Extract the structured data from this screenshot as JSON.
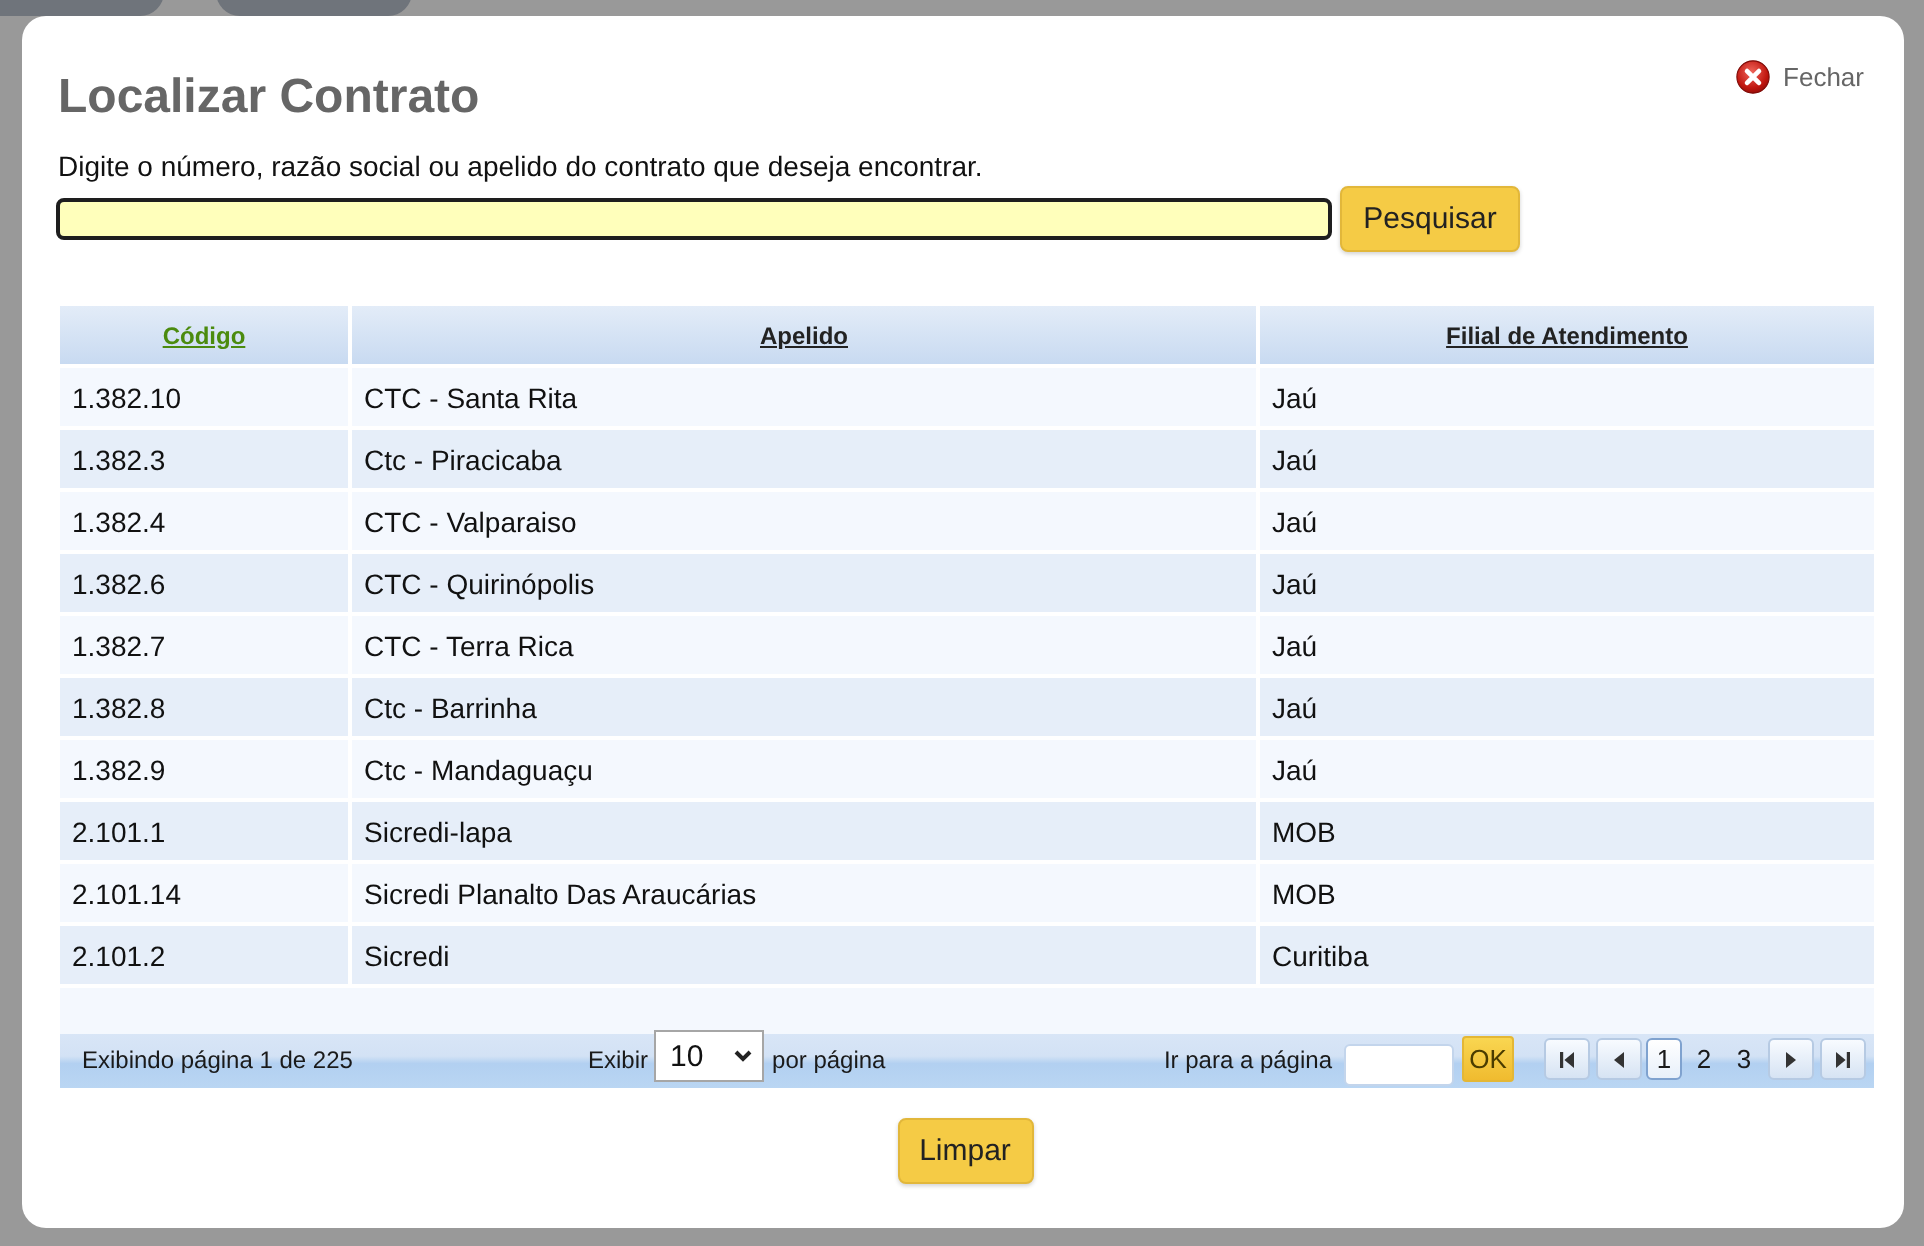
{
  "dialog": {
    "title": "Localizar Contrato",
    "close_label": "Fechar",
    "instruction": "Digite o número, razão social ou apelido do contrato que deseja encontrar.",
    "search_field": {
      "focused": true
    },
    "search_button": "Pesquisar"
  },
  "table": {
    "columns": [
      {
        "label": "Código",
        "sorted": true
      },
      {
        "label": "Apelido",
        "sorted": false
      },
      {
        "label": "Filial de Atendimento",
        "sorted": false
      }
    ],
    "rows": [
      {
        "cells": [
          "1.382.10",
          "CTC - Santa Rita",
          "Jaú"
        ]
      },
      {
        "cells": [
          "1.382.3",
          "Ctc - Piracicaba",
          "Jaú"
        ]
      },
      {
        "cells": [
          "1.382.4",
          "CTC - Valparaiso",
          "Jaú"
        ]
      },
      {
        "cells": [
          "1.382.6",
          "CTC - Quirinópolis",
          "Jaú"
        ]
      },
      {
        "cells": [
          "1.382.7",
          "CTC - Terra Rica",
          "Jaú"
        ]
      },
      {
        "cells": [
          "1.382.8",
          "Ctc - Barrinha",
          "Jaú"
        ]
      },
      {
        "cells": [
          "1.382.9",
          "Ctc - Mandaguaçu",
          "Jaú"
        ]
      },
      {
        "cells": [
          "2.101.1",
          "Sicredi-lapa",
          "MOB"
        ]
      },
      {
        "cells": [
          "2.101.14",
          "Sicredi Planalto Das Araucárias",
          "MOB"
        ]
      },
      {
        "cells": [
          "2.101.2",
          "Sicredi",
          "Curitiba"
        ]
      }
    ]
  },
  "pager": {
    "status": "Exibindo página 1 de 225",
    "show_label": "Exibir",
    "page_size": "10",
    "per_page_label": "por página",
    "goto_label": "Ir para a página",
    "ok_button": "OK",
    "pages": [
      {
        "label": "1",
        "selected": true
      },
      {
        "label": "2",
        "selected": false
      },
      {
        "label": "3",
        "selected": false
      }
    ]
  },
  "clear_button": "Limpar"
}
